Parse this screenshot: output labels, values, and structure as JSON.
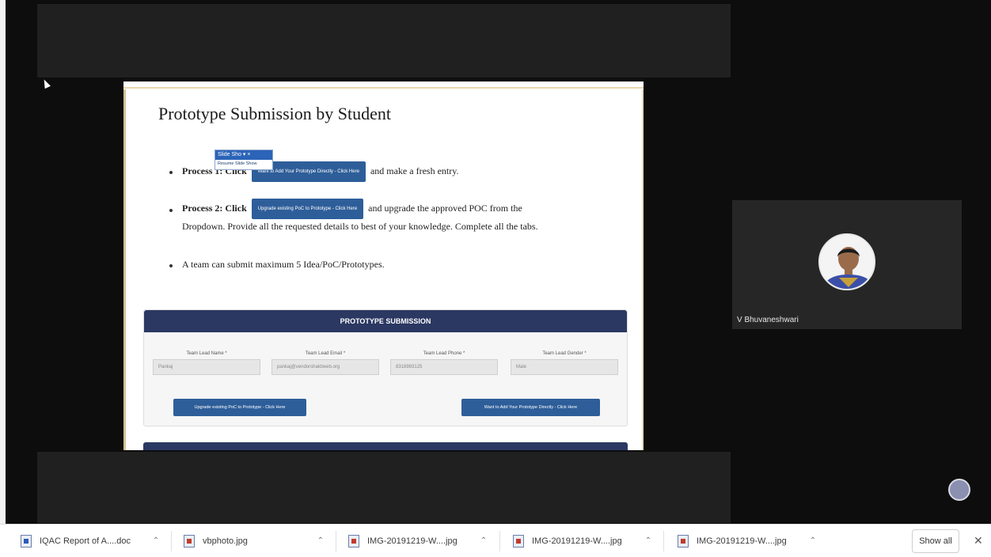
{
  "slide": {
    "title": "Prototype Submission by  Student",
    "bullet1_prefix": "Process 1: Click",
    "bullet1_button": "Want to Add Your Prototype Directly - Click Here",
    "bullet1_suffix": "and make a fresh entry.",
    "bullet2_prefix": "Process 2: Click",
    "bullet2_button": "Upgrade existing PoC to Prototype - Click Here",
    "bullet2_suffix": "and upgrade the approved POC from the",
    "bullet2_line2": "Dropdown. Provide all the requested details to best of your knowledge. Complete all the tabs.",
    "bullet3": "A team can submit maximum 5 Idea/PoC/Prototypes."
  },
  "slideshow_popup": {
    "title": "Slide Sho",
    "item": "Resume Slide Show"
  },
  "panel": {
    "title": "PROTOTYPE SUBMISSION",
    "fields": [
      {
        "label": "Team Lead Name *",
        "value": "Pankaj"
      },
      {
        "label": "Team Lead Email *",
        "value": "pankaj@vendorshaktiweb.org"
      },
      {
        "label": "Team Lead Phone *",
        "value": "8318983125"
      },
      {
        "label": "Team Lead Gender *",
        "value": "Male"
      }
    ],
    "button_upgrade": "Upgrade existing PoC to Prototype - Click Here",
    "button_add": "Want to Add Your Prototype Directly - Click Here"
  },
  "participant": {
    "name": "V Bhuvaneshwari"
  },
  "downloads": {
    "items": [
      {
        "name": "IQAC Report of A....doc",
        "type": "doc"
      },
      {
        "name": "vbphoto.jpg",
        "type": "img"
      },
      {
        "name": "IMG-20191219-W....jpg",
        "type": "img"
      },
      {
        "name": "IMG-20191219-W....jpg",
        "type": "img"
      },
      {
        "name": "IMG-20191219-W....jpg",
        "type": "img"
      }
    ],
    "show_all": "Show all",
    "close": "✕"
  },
  "colors": {
    "panel_header": "#2b3862",
    "button_blue": "#2e5e99",
    "meeting_bg": "#0d0d0d"
  }
}
